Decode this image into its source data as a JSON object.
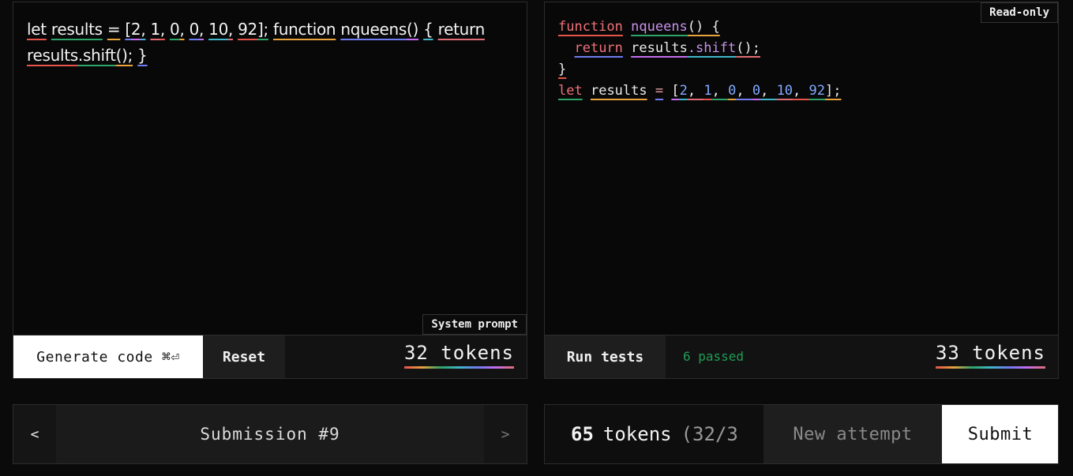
{
  "prompt_editor": {
    "tokens": [
      "let",
      " results",
      " =",
      " [",
      "2",
      ",",
      " 1",
      ",",
      " 0",
      ",",
      " 0",
      ",",
      " 10",
      ",",
      " 92",
      "];",
      " function",
      " nqueens",
      "()",
      " {",
      " return",
      " results",
      ".shift",
      "();",
      " }"
    ],
    "label": "System prompt",
    "generate_label": "Generate code ⌘⏎",
    "reset_label": "Reset",
    "token_count": "32 tokens"
  },
  "code_panel": {
    "badge": "Read-only",
    "lines": [
      {
        "parts": [
          "function",
          " nqueens",
          "() {"
        ]
      },
      {
        "parts": [
          "  return",
          " results",
          ".shift",
          "();"
        ]
      },
      {
        "parts": [
          "}"
        ]
      },
      {
        "parts": [
          "let",
          " results",
          " =",
          " [",
          "2",
          ", ",
          "1",
          ", ",
          "0",
          ", ",
          "0",
          ", ",
          "10",
          ", ",
          "92",
          "];"
        ]
      }
    ],
    "run_tests_label": "Run tests",
    "tests_status": "6 passed",
    "token_count": "33 tokens"
  },
  "navigation": {
    "prev_label": "<",
    "next_label": ">",
    "submission_label": "Submission #9"
  },
  "submission": {
    "total_number": "65",
    "total_unit": "tokens",
    "breakdown": "(32/3",
    "new_attempt_label": "New attempt",
    "submit_label": "Submit"
  },
  "colors": {
    "background": "#0a0a0a",
    "status_green": "#1f9d55",
    "keyword": "#f07178",
    "function": "#c792ea",
    "number": "#82aaff"
  }
}
